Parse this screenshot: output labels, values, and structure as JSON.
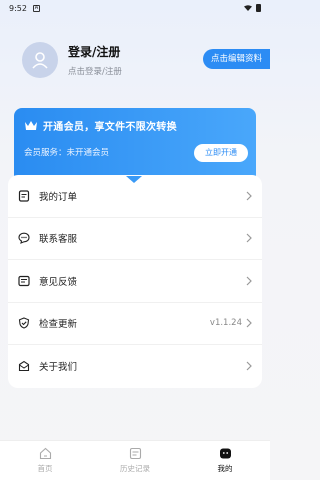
{
  "status_bar": {
    "time": "9:52",
    "notification": "A"
  },
  "profile": {
    "title": "登录/注册",
    "subtitle": "点击登录/注册",
    "edit_label": "点击编辑资料"
  },
  "vip": {
    "title": "开通会员，享文件不限次转换",
    "status": "会员服务：未开通会员",
    "button": "立即开通"
  },
  "menu": {
    "items": [
      {
        "label": "我的订单",
        "icon": "order-icon"
      },
      {
        "label": "联系客服",
        "icon": "chat-icon"
      },
      {
        "label": "意见反馈",
        "icon": "feedback-icon"
      },
      {
        "label": "检查更新",
        "icon": "shield-icon",
        "value": "v1.1.24"
      },
      {
        "label": "关于我们",
        "icon": "mail-icon"
      }
    ]
  },
  "tabs": [
    {
      "label": "首页",
      "icon": "home-icon"
    },
    {
      "label": "历史记录",
      "icon": "history-icon"
    },
    {
      "label": "我的",
      "icon": "profile-icon",
      "active": true
    }
  ]
}
